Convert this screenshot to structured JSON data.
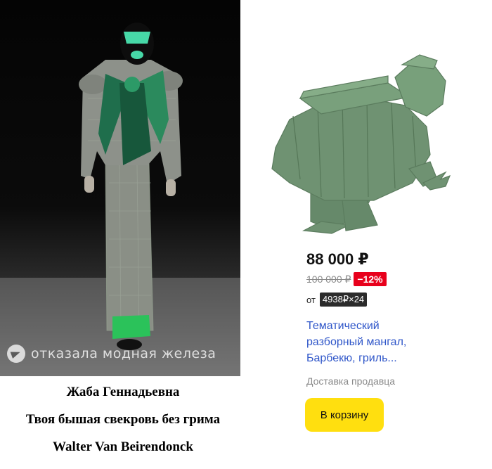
{
  "photo": {
    "watermark_text": "отказала модная железа",
    "watermark_icon": "telegram-icon"
  },
  "captions": {
    "line1": "Жаба Геннадьевна",
    "line2": "Твоя бышая свекровь без грима",
    "line3": "Walter Van Beirendonck"
  },
  "product": {
    "image_icon": "frog-grill-image",
    "price": "88 000 ₽",
    "old_price": "100 000 ₽",
    "discount": "−12%",
    "installment_prefix": "от",
    "installment": "4938₽×24",
    "title_lines": [
      "Тематический",
      "разборный мангал,",
      "Барбекю, гриль..."
    ],
    "delivery": "Доставка продавца",
    "cart_button": "В корзину"
  },
  "colors": {
    "accent_yellow": "#ffdf0f",
    "discount_red": "#e8001c",
    "link_blue": "#2f56c9",
    "frog_green": "#6f9272"
  }
}
